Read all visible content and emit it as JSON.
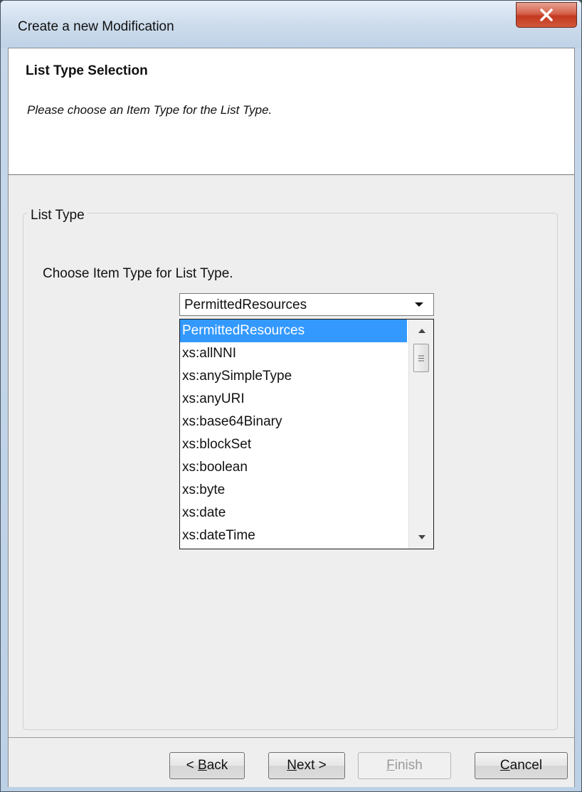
{
  "window": {
    "title": "Create a new Modification"
  },
  "header": {
    "title": "List Type Selection",
    "description": "Please choose an Item Type for the List Type."
  },
  "group": {
    "legend": "List Type",
    "choose_label": "Choose Item Type for List Type."
  },
  "combo": {
    "selected_value": "PermittedResources",
    "options": [
      "PermittedResources",
      "xs:allNNI",
      "xs:anySimpleType",
      "xs:anyURI",
      "xs:base64Binary",
      "xs:blockSet",
      "xs:boolean",
      "xs:byte",
      "xs:date",
      "xs:dateTime"
    ]
  },
  "buttons": {
    "back": {
      "prefix": "< ",
      "mnemonic": "B",
      "rest": "ack"
    },
    "next": {
      "mnemonic": "N",
      "rest": "ext >"
    },
    "finish": {
      "mnemonic": "F",
      "rest": "inish"
    },
    "cancel": {
      "mnemonic": "C",
      "rest": "ancel"
    }
  },
  "colors": {
    "selection": "#3399ff",
    "close_button": "#c2391f"
  },
  "icons": {
    "close": "close-icon",
    "dropdown": "chevron-down-icon",
    "scroll_up": "scroll-up-arrow-icon",
    "scroll_down": "scroll-down-arrow-icon",
    "grip": "scroll-grip-icon"
  }
}
